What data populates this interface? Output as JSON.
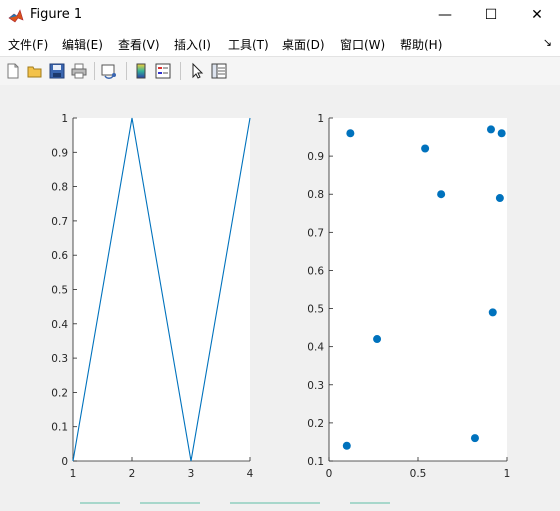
{
  "window": {
    "title": "Figure 1",
    "minimize_glyph": "—",
    "maximize_glyph": "☐",
    "close_glyph": "✕"
  },
  "menu": {
    "items": [
      "文件(F)",
      "编辑(E)",
      "查看(V)",
      "插入(I)",
      "工具(T)",
      "桌面(D)",
      "窗口(W)",
      "帮助(H)"
    ],
    "overflow_glyph": "↘"
  },
  "toolbar": {
    "tools": [
      "new-figure-icon",
      "open-file-icon",
      "save-icon",
      "print-icon",
      "link-plot-icon",
      "insert-colorbar-icon",
      "insert-legend-icon",
      "pointer-icon",
      "property-editor-icon"
    ]
  },
  "colors": {
    "series": "#0072bd",
    "axes_bg": "#ffffff",
    "figure_bg": "#f0f0f0"
  },
  "chart_data": [
    {
      "type": "line",
      "x": [
        1,
        2,
        3,
        4
      ],
      "y": [
        0,
        1,
        0,
        1
      ],
      "xlim": [
        1,
        4
      ],
      "ylim": [
        0,
        1
      ],
      "xticks": [
        "1",
        "2",
        "3",
        "4"
      ],
      "yticks": [
        "0",
        "0.1",
        "0.2",
        "0.3",
        "0.4",
        "0.5",
        "0.6",
        "0.7",
        "0.8",
        "0.9",
        "1"
      ],
      "grid": false,
      "color": "#0072bd"
    },
    {
      "type": "scatter",
      "points": [
        {
          "x": 0.12,
          "y": 0.96
        },
        {
          "x": 0.54,
          "y": 0.92
        },
        {
          "x": 0.63,
          "y": 0.8
        },
        {
          "x": 0.91,
          "y": 0.97
        },
        {
          "x": 0.97,
          "y": 0.96
        },
        {
          "x": 0.96,
          "y": 0.79
        },
        {
          "x": 0.27,
          "y": 0.42
        },
        {
          "x": 0.92,
          "y": 0.49
        },
        {
          "x": 0.1,
          "y": 0.14
        },
        {
          "x": 0.82,
          "y": 0.16
        }
      ],
      "xlim": [
        0,
        1
      ],
      "ylim": [
        0.1,
        1
      ],
      "xticks": [
        "0",
        "0.5",
        "1"
      ],
      "yticks": [
        "0.1",
        "0.2",
        "0.3",
        "0.4",
        "0.5",
        "0.6",
        "0.7",
        "0.8",
        "0.9",
        "1"
      ],
      "grid": false,
      "color": "#0072bd"
    }
  ]
}
